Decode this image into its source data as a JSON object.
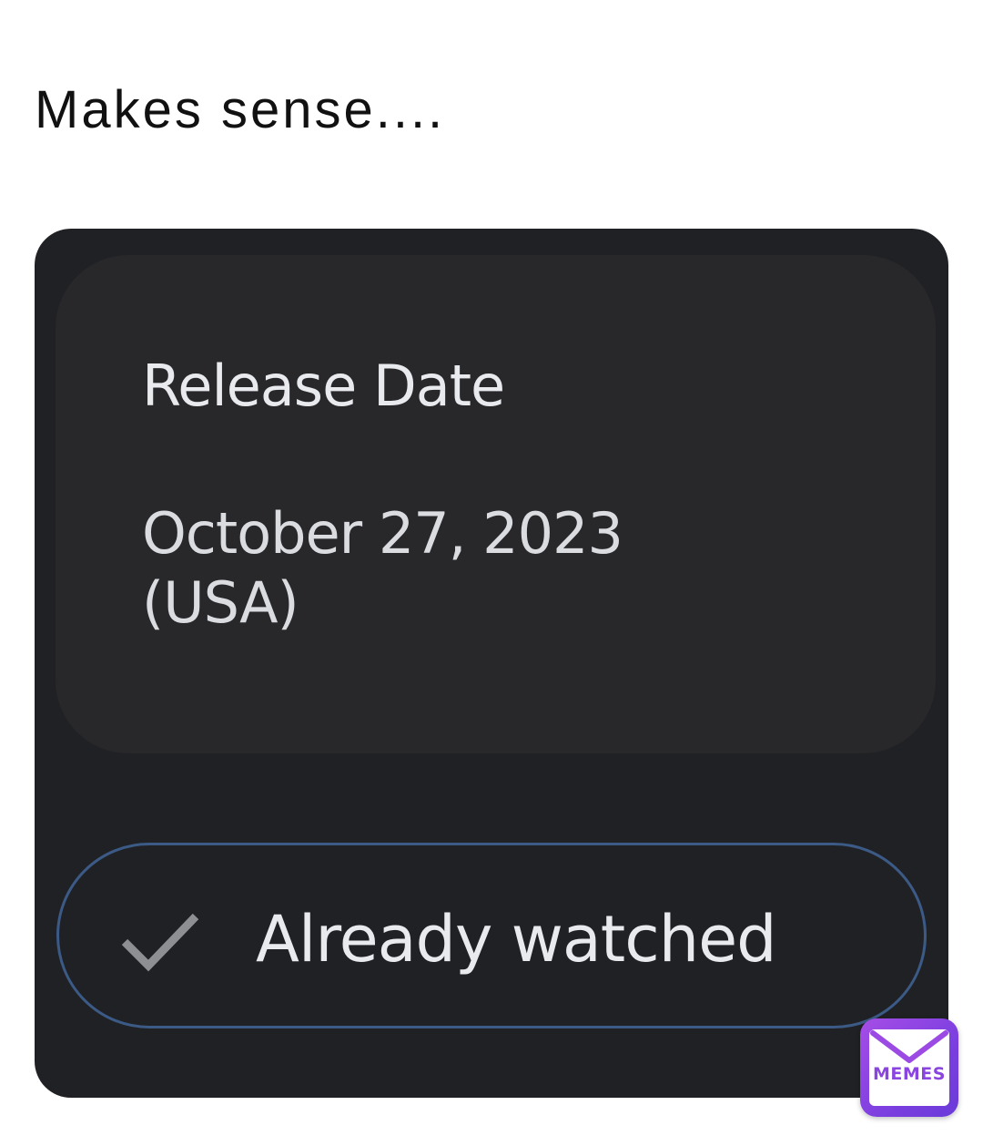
{
  "post": {
    "caption": "Makes sense...."
  },
  "release_card": {
    "label": "Release Date",
    "value": "October 27, 2023 (USA)"
  },
  "watched_button": {
    "label": "Already watched",
    "icon": "check-icon",
    "border_color": "#3c5a86"
  },
  "watermark": {
    "text": "MEMES",
    "icon": "envelope-icon",
    "color": "#8a44e0"
  },
  "colors": {
    "background": "#ffffff",
    "screenshot_background": "#202124",
    "card_background": "#28282b",
    "text_primary": "#e8eaed"
  }
}
